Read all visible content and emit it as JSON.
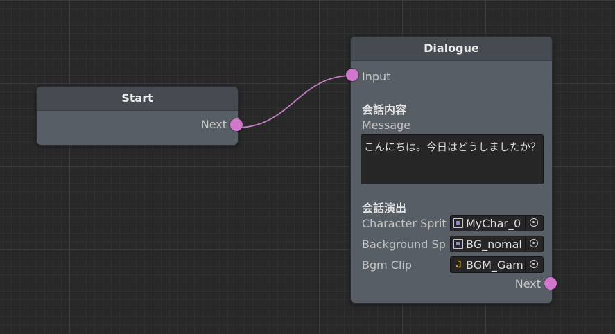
{
  "colors": {
    "port": "#d077cc",
    "canvas": "#282828",
    "node_body": "#585e66",
    "node_header": "#464b52"
  },
  "start_node": {
    "title": "Start",
    "output_label": "Next"
  },
  "dialogue_node": {
    "title": "Dialogue",
    "input_label": "Input",
    "section_content": "会話内容",
    "message_label": "Message",
    "message_value": "こんにちは。今日はどうしましたか？",
    "section_direction": "会話演出",
    "fields": [
      {
        "label": "Character Sprit",
        "value": "MyChar_0",
        "icon": "sprite-icon"
      },
      {
        "label": "Background Sp",
        "value": "BG_nomal",
        "icon": "sprite-icon"
      },
      {
        "label": "Bgm Clip",
        "value": "BGM_Gam",
        "icon": "music-icon"
      }
    ],
    "output_label": "Next"
  }
}
